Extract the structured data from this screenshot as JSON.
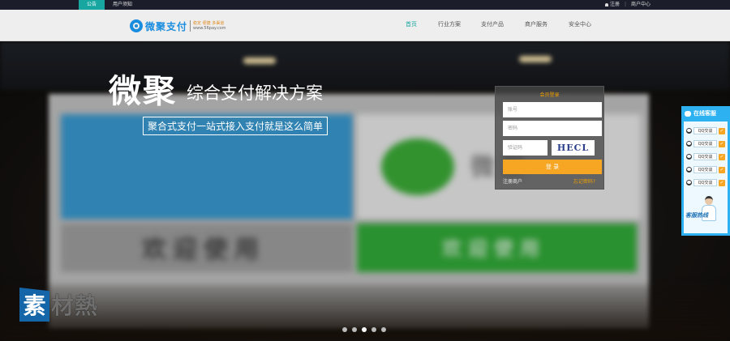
{
  "topbar": {
    "tabs": [
      {
        "label": "公告"
      },
      {
        "label": "用户须知"
      }
    ],
    "right": {
      "register": "注册",
      "center": "商户中心"
    }
  },
  "header": {
    "logo_name": "微聚支付",
    "logo_slogan": "稳定 便捷 多渠道",
    "logo_url": "www.56pay.com",
    "nav": [
      "首页",
      "行业方案",
      "支付产品",
      "商户服务",
      "安全中心"
    ],
    "active_nav": "首页"
  },
  "hero": {
    "brand": "微聚",
    "subheading": "综合支付解决方案",
    "tagline": "聚合式支付一站式接入支付就是这么简单",
    "board_left_text": "欢迎使用",
    "board_right_text": "欢迎使用",
    "board_brand": "微聚"
  },
  "login": {
    "title": "会员登录",
    "account_placeholder": "账号",
    "password_placeholder": "密码",
    "captcha_placeholder": "验证码",
    "captcha_text": "HECL",
    "submit": "登 录",
    "register_link": "注册商户",
    "forgot_link": "忘记密码?"
  },
  "customer_service": {
    "title": "在线客服",
    "items": [
      "QQ交谈",
      "QQ交谈",
      "QQ交谈",
      "QQ交谈",
      "QQ交谈"
    ],
    "footer": "客服热线"
  },
  "watermark": {
    "badge": "素",
    "rest": "材熱"
  },
  "carousel": {
    "active_index": 2,
    "count": 5
  },
  "colors": {
    "accent": "#17a7a0",
    "brand_blue": "#1a8ddf",
    "orange": "#f6a623",
    "cs_blue": "#2db1f0"
  }
}
